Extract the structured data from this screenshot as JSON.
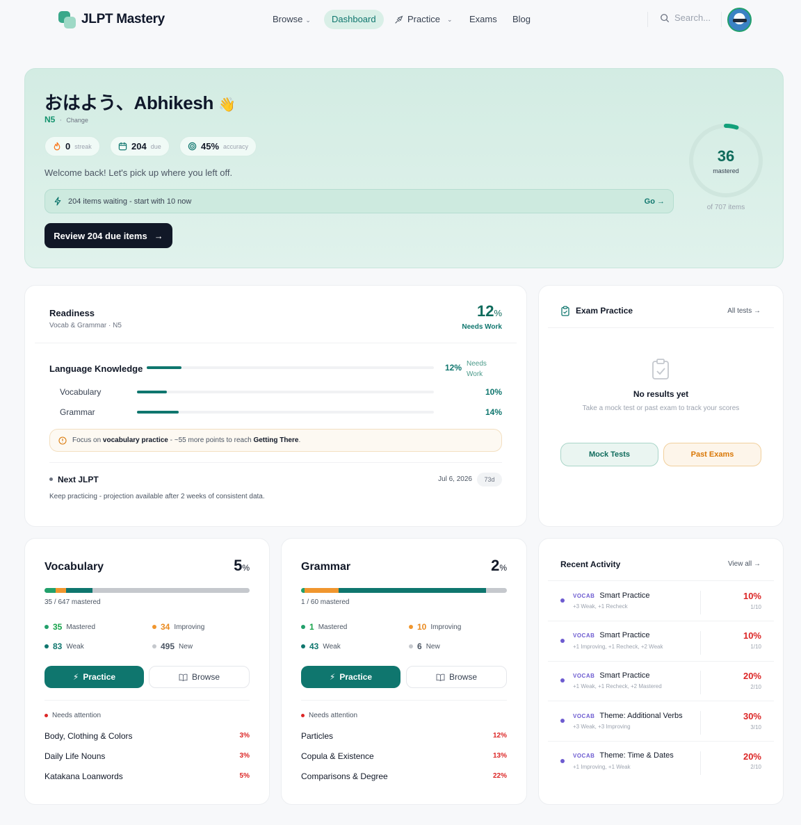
{
  "header": {
    "logo_text": "JLPT Mastery",
    "nav": [
      {
        "label": "Browse",
        "has_menu": true
      },
      {
        "label": "Dashboard",
        "active": true
      },
      {
        "label": "Practice",
        "has_menu": true
      },
      {
        "label": "Exams"
      },
      {
        "label": "Blog"
      }
    ],
    "search_placeholder": "Search..."
  },
  "hero": {
    "greeting": "おはよう、Abhikesh",
    "greeting_emoji": "👋",
    "level": "N5",
    "change_label": "Change",
    "stats": [
      {
        "value": "0",
        "label": "streak",
        "icon": "flame-icon"
      },
      {
        "value": "204",
        "label": "due",
        "icon": "calendar-icon"
      },
      {
        "value": "45%",
        "label": "accuracy",
        "icon": "target-icon"
      }
    ],
    "welcome": "Welcome back! Let's pick up where you left off.",
    "waiting_text": "204 items waiting - start with 10 now",
    "go_label": "Go",
    "review_button": "Review 204 due items",
    "mastered_count": "36",
    "mastered_label": "mastered",
    "mastered_of": "of 707 items",
    "mastered_fraction": 0.05
  },
  "readiness": {
    "title": "Readiness",
    "subtitle": "Vocab & Grammar · N5",
    "percent": "12",
    "status": "Needs Work",
    "language_knowledge": {
      "label": "Language Knowledge",
      "percent": "12%",
      "status": "Needs Work",
      "fraction": 0.12
    },
    "rows": [
      {
        "label": "Vocabulary",
        "percent": "10%",
        "fraction": 0.1
      },
      {
        "label": "Grammar",
        "percent": "14%",
        "fraction": 0.14
      }
    ],
    "focus": {
      "prefix": "Focus on",
      "topic": "vocabulary practice",
      "middle": "- ~55 more points to reach",
      "target": "Getting There",
      "suffix": "."
    },
    "next_title": "Next JLPT",
    "next_date": "Jul 6, 2026",
    "next_days": "73d",
    "next_sub": "Keep practicing - projection available after 2 weeks of consistent data."
  },
  "exam": {
    "title": "Exam Practice",
    "all_tests": "All tests",
    "empty_title": "No results yet",
    "empty_sub": "Take a mock test or past exam to track your scores",
    "mock_label": "Mock Tests",
    "past_label": "Past Exams"
  },
  "vocabulary": {
    "title": "Vocabulary",
    "percent": "5",
    "mastered_text": "35 / 647 mastered",
    "segments": {
      "mastered": 35,
      "improving": 34,
      "weak": 83,
      "new": 495
    },
    "stats": [
      {
        "value": "35",
        "label": "Mastered",
        "color": "#22a06b"
      },
      {
        "value": "34",
        "label": "Improving",
        "color": "#f0962e"
      },
      {
        "value": "83",
        "label": "Weak",
        "color": "#0f766e"
      },
      {
        "value": "495",
        "label": "New",
        "color": "#c5c8cd"
      }
    ],
    "practice_label": "Practice",
    "browse_label": "Browse",
    "attention_label": "Needs attention",
    "attention": [
      {
        "name": "Body, Clothing & Colors",
        "pct": "3%"
      },
      {
        "name": "Daily Life Nouns",
        "pct": "3%"
      },
      {
        "name": "Katakana Loanwords",
        "pct": "5%"
      }
    ]
  },
  "grammar": {
    "title": "Grammar",
    "percent": "2",
    "mastered_text": "1 / 60 mastered",
    "segments": {
      "mastered": 1,
      "improving": 10,
      "weak": 43,
      "new": 6
    },
    "stats": [
      {
        "value": "1",
        "label": "Mastered",
        "color": "#22a06b"
      },
      {
        "value": "10",
        "label": "Improving",
        "color": "#f0962e"
      },
      {
        "value": "43",
        "label": "Weak",
        "color": "#0f766e"
      },
      {
        "value": "6",
        "label": "New",
        "color": "#c5c8cd"
      }
    ],
    "practice_label": "Practice",
    "browse_label": "Browse",
    "attention_label": "Needs attention",
    "attention": [
      {
        "name": "Particles",
        "pct": "12%"
      },
      {
        "name": "Copula & Existence",
        "pct": "13%"
      },
      {
        "name": "Comparisons & Degree",
        "pct": "22%"
      }
    ]
  },
  "activity": {
    "title": "Recent Activity",
    "view_all": "View all",
    "items": [
      {
        "tag": "VOCAB",
        "name": "Smart Practice",
        "sub": "+3 Weak, +1 Recheck",
        "pct": "10%",
        "frac": "1/10"
      },
      {
        "tag": "VOCAB",
        "name": "Smart Practice",
        "sub": "+1 Improving, +1 Recheck, +2 Weak",
        "pct": "10%",
        "frac": "1/10"
      },
      {
        "tag": "VOCAB",
        "name": "Smart Practice",
        "sub": "+1 Weak, +1 Recheck, +2 Mastered",
        "pct": "20%",
        "frac": "2/10"
      },
      {
        "tag": "VOCAB",
        "name": "Theme: Additional Verbs",
        "sub": "+3 Weak, +3 Improving",
        "pct": "30%",
        "frac": "3/10"
      },
      {
        "tag": "VOCAB",
        "name": "Theme: Time & Dates",
        "sub": "+1 Improving, +1 Weak",
        "pct": "20%",
        "frac": "2/10"
      }
    ]
  }
}
